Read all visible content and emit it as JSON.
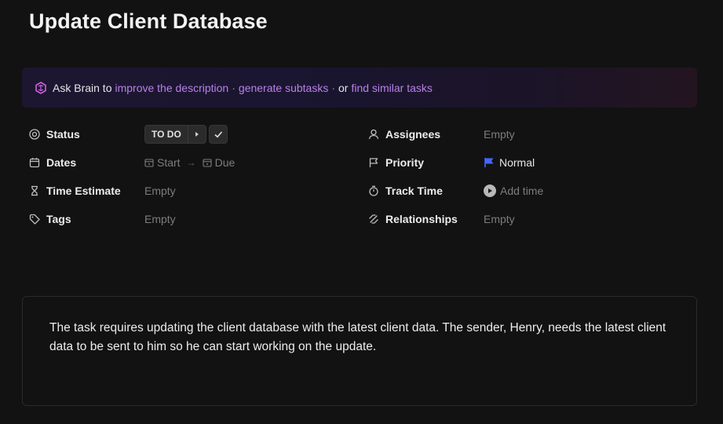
{
  "task": {
    "title": "Update Client Database"
  },
  "brain": {
    "ask": "Ask Brain to",
    "improve": "improve the description",
    "generate": "generate subtasks",
    "or": "or",
    "similar": "find similar tasks",
    "separator": "·"
  },
  "fields": {
    "status": {
      "label": "Status",
      "value": "TO DO"
    },
    "dates": {
      "label": "Dates",
      "start": "Start",
      "due": "Due",
      "arrow": "→"
    },
    "time_estimate": {
      "label": "Time Estimate",
      "value": "Empty"
    },
    "tags": {
      "label": "Tags",
      "value": "Empty"
    },
    "assignees": {
      "label": "Assignees",
      "value": "Empty"
    },
    "priority": {
      "label": "Priority",
      "value": "Normal",
      "flag_color": "#4466ff"
    },
    "track_time": {
      "label": "Track Time",
      "value": "Add time"
    },
    "relationships": {
      "label": "Relationships",
      "value": "Empty"
    }
  },
  "description": "The task requires updating the client database with the latest client data. The sender, Henry, needs the latest client data to be sent to him so he can start working on the update.",
  "colors": {
    "background": "#121212",
    "link": "#b980e8",
    "muted": "#7d7d7d"
  }
}
